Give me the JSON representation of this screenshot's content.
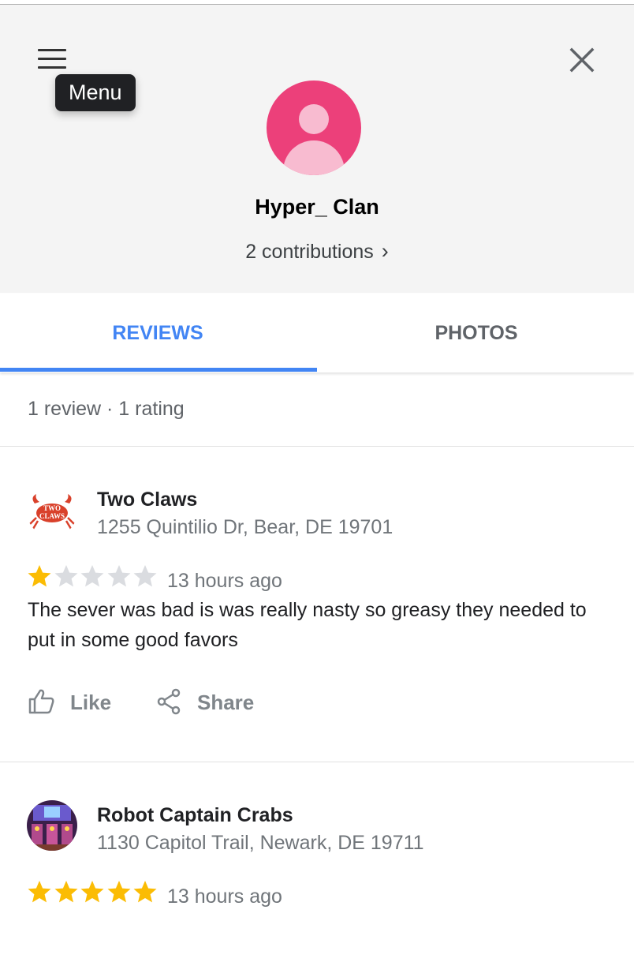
{
  "header": {
    "menu_tooltip": "Menu",
    "user_name": "Hyper_ Clan",
    "contributions_label": "2 contributions",
    "contributions_chevron": "›"
  },
  "tabs": [
    {
      "label": "REVIEWS",
      "active": true
    },
    {
      "label": "PHOTOS",
      "active": false
    }
  ],
  "summary": "1 review · 1 rating",
  "colors": {
    "accent": "#4285f4",
    "avatar_bg": "#ec407a",
    "star_filled": "#fbbc04",
    "star_empty": "#dadce0"
  },
  "reviews": [
    {
      "place_name": "Two Claws",
      "address": "1255 Quintilio Dr, Bear, DE 19701",
      "rating": 1,
      "max_rating": 5,
      "time": "13 hours ago",
      "text": "The sever was bad is was really nasty so greasy they needed to put in some good favors",
      "logo_icon": "two-claws-crab-logo",
      "logo_text": "TWO CLAWS",
      "actions": {
        "like": "Like",
        "share": "Share"
      }
    },
    {
      "place_name": "Robot Captain Crabs",
      "address": "1130 Capitol Trail, Newark, DE 19711",
      "rating": 5,
      "max_rating": 5,
      "time": "13 hours ago",
      "logo_icon": "robot-captain-crabs-photo"
    }
  ]
}
